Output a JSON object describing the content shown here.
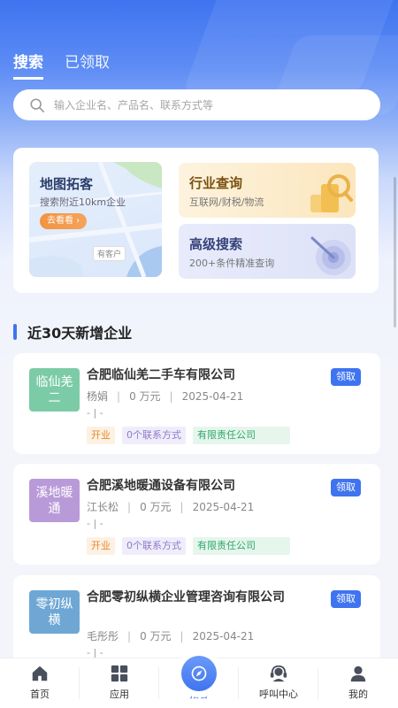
{
  "tabs": [
    {
      "label": "搜索",
      "active": true
    },
    {
      "label": "已领取",
      "active": false
    }
  ],
  "search": {
    "placeholder": "输入企业名、产品名、联系方式等",
    "icon": "search-icon"
  },
  "features": {
    "map": {
      "title": "地图拓客",
      "subtitle": "搜索附近10km企业",
      "button": "去看看 ›",
      "pin": "有客户"
    },
    "industry": {
      "title": "行业查询",
      "subtitle": "互联网/财税/物流"
    },
    "advanced": {
      "title": "高级搜索",
      "subtitle": "200+条件精准查询"
    }
  },
  "section": {
    "title": "近30天新增企业"
  },
  "companies": [
    {
      "avatar": "临仙羌二",
      "avatar_color": "#7ccba7",
      "name": "合肥临仙羌二手车有限公司",
      "contact": "杨娟",
      "capital": "0 万元",
      "date": "2025-04-21",
      "extra": "-  |  -",
      "tags": [
        "开业",
        "0个联系方式",
        "有限责任公司"
      ],
      "claim": "领取"
    },
    {
      "avatar": "溪地暖通",
      "avatar_color": "#b99ad8",
      "name": "合肥溪地暖通设备有限公司",
      "contact": "江长松",
      "capital": "0 万元",
      "date": "2025-04-21",
      "extra": "-  |  -",
      "tags": [
        "开业",
        "0个联系方式",
        "有限责任公司"
      ],
      "claim": "领取"
    },
    {
      "avatar": "零初纵横",
      "avatar_color": "#6fa7d4",
      "name": "合肥零初纵横企业管理咨询有限公司",
      "contact": "毛彤彤",
      "capital": "0 万元",
      "date": "2025-04-21",
      "extra": "-  |  -",
      "tags": [],
      "claim": "领取"
    }
  ],
  "nav": [
    {
      "label": "首页",
      "icon": "home-icon"
    },
    {
      "label": "应用",
      "icon": "apps-icon"
    },
    {
      "label": "拓客",
      "icon": "compass-icon",
      "active": true
    },
    {
      "label": "呼叫中心",
      "icon": "headset-icon"
    },
    {
      "label": "我的",
      "icon": "user-icon"
    }
  ],
  "colors": {
    "primary": "#3f74f0"
  }
}
